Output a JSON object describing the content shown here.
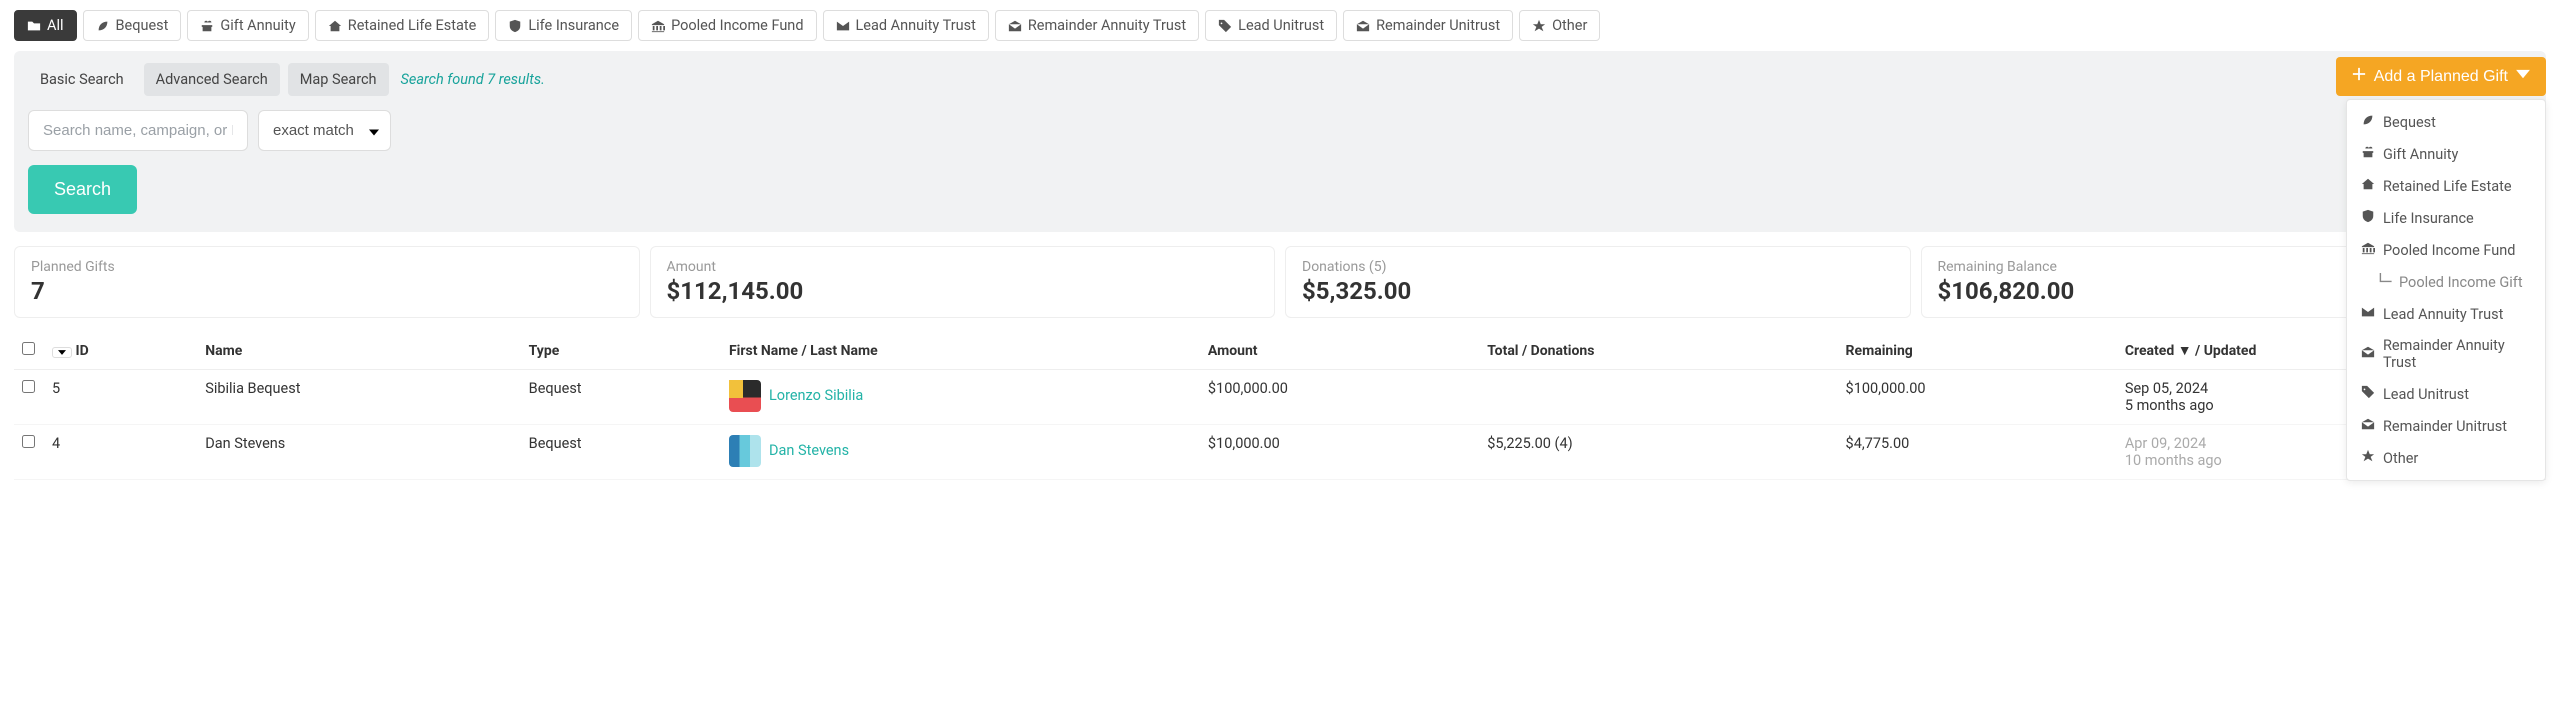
{
  "filters": {
    "all": "All",
    "bequest": "Bequest",
    "gift_annuity": "Gift Annuity",
    "retained": "Retained Life Estate",
    "life_ins": "Life Insurance",
    "pooled": "Pooled Income Fund",
    "lead_ann": "Lead Annuity Trust",
    "rem_ann": "Remainder Annuity Trust",
    "lead_uni": "Lead Unitrust",
    "rem_uni": "Remainder Unitrust",
    "other": "Other"
  },
  "search_tabs": {
    "basic": "Basic Search",
    "advanced": "Advanced Search",
    "map": "Map Search"
  },
  "results_text": "Search found 7 results.",
  "search": {
    "placeholder": "Search name, campaign, or ID...",
    "match_mode": "exact match",
    "button": "Search"
  },
  "add_button": "Add a Planned Gift",
  "dropdown": {
    "bequest": "Bequest",
    "gift_annuity": "Gift Annuity",
    "retained": "Retained Life Estate",
    "life_ins": "Life Insurance",
    "pooled": "Pooled Income Fund",
    "pooled_sub": "Pooled Income Gift",
    "lead_ann": "Lead Annuity Trust",
    "rem_ann": "Remainder Annuity Trust",
    "lead_uni": "Lead Unitrust",
    "rem_uni": "Remainder Unitrust",
    "other": "Other"
  },
  "stats": {
    "planned_gifts": {
      "label": "Planned Gifts",
      "value": "7"
    },
    "amount": {
      "label": "Amount",
      "value": "$112,145.00"
    },
    "donations": {
      "label": "Donations (5)",
      "value": "$5,325.00"
    },
    "remaining": {
      "label": "Remaining Balance",
      "value": "$106,820.00"
    }
  },
  "columns": {
    "id": "ID",
    "name": "Name",
    "type": "Type",
    "person": "First Name / Last Name",
    "amount": "Amount",
    "total": "Total / Donations",
    "remaining": "Remaining",
    "created": "Created ▼ / Updated"
  },
  "rows": [
    {
      "id": "5",
      "name": "Sibilia Bequest",
      "type": "Bequest",
      "person": "Lorenzo Sibilia",
      "amount": "$100,000.00",
      "total": "",
      "remaining": "$100,000.00",
      "created": "Sep 05, 2024",
      "updated": "5 months ago",
      "updated_muted": false
    },
    {
      "id": "4",
      "name": "Dan Stevens",
      "type": "Bequest",
      "person": "Dan Stevens",
      "amount": "$10,000.00",
      "total": "$5,225.00 (4)",
      "remaining": "$4,775.00",
      "created": "Apr 09, 2024",
      "updated": "10 months ago",
      "updated_muted": true
    }
  ]
}
